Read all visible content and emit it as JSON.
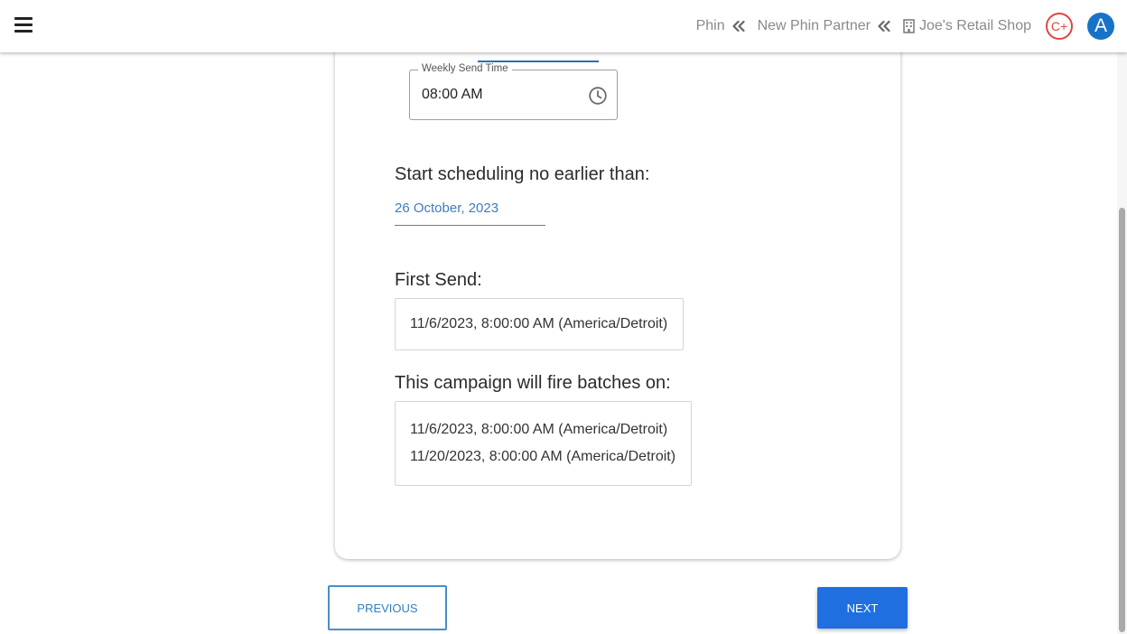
{
  "header": {
    "menu_icon": "hamburger-menu-icon",
    "breadcrumbs": [
      {
        "label": "Phin",
        "icon": "double-chevron-left-icon"
      },
      {
        "label": "New Phin Partner",
        "icon": "double-chevron-left-icon"
      },
      {
        "label": "Joe's Retail Shop",
        "icon": "building-icon"
      }
    ],
    "grade_badge": "C+",
    "avatar_letter": "A"
  },
  "form": {
    "weekly_send_time": {
      "label": "Weekly Send Time",
      "value": "08:00 AM",
      "icon": "clock-icon"
    },
    "start_scheduling": {
      "label": "Start scheduling no earlier than:",
      "value": "26 October, 2023"
    },
    "first_send": {
      "label": "First Send:",
      "value": "11/6/2023, 8:00:00 AM (America/Detroit)"
    },
    "batches": {
      "label": "This campaign will fire batches on:",
      "items": [
        "11/6/2023, 8:00:00 AM (America/Detroit)",
        "11/20/2023, 8:00:00 AM (America/Detroit)"
      ]
    }
  },
  "footer": {
    "previous_label": "PREVIOUS",
    "next_label": "NEXT"
  },
  "colors": {
    "primary": "#1f6fe0",
    "link": "#3c7dbf",
    "badge": "#e0453f",
    "avatar": "#1773c7"
  }
}
